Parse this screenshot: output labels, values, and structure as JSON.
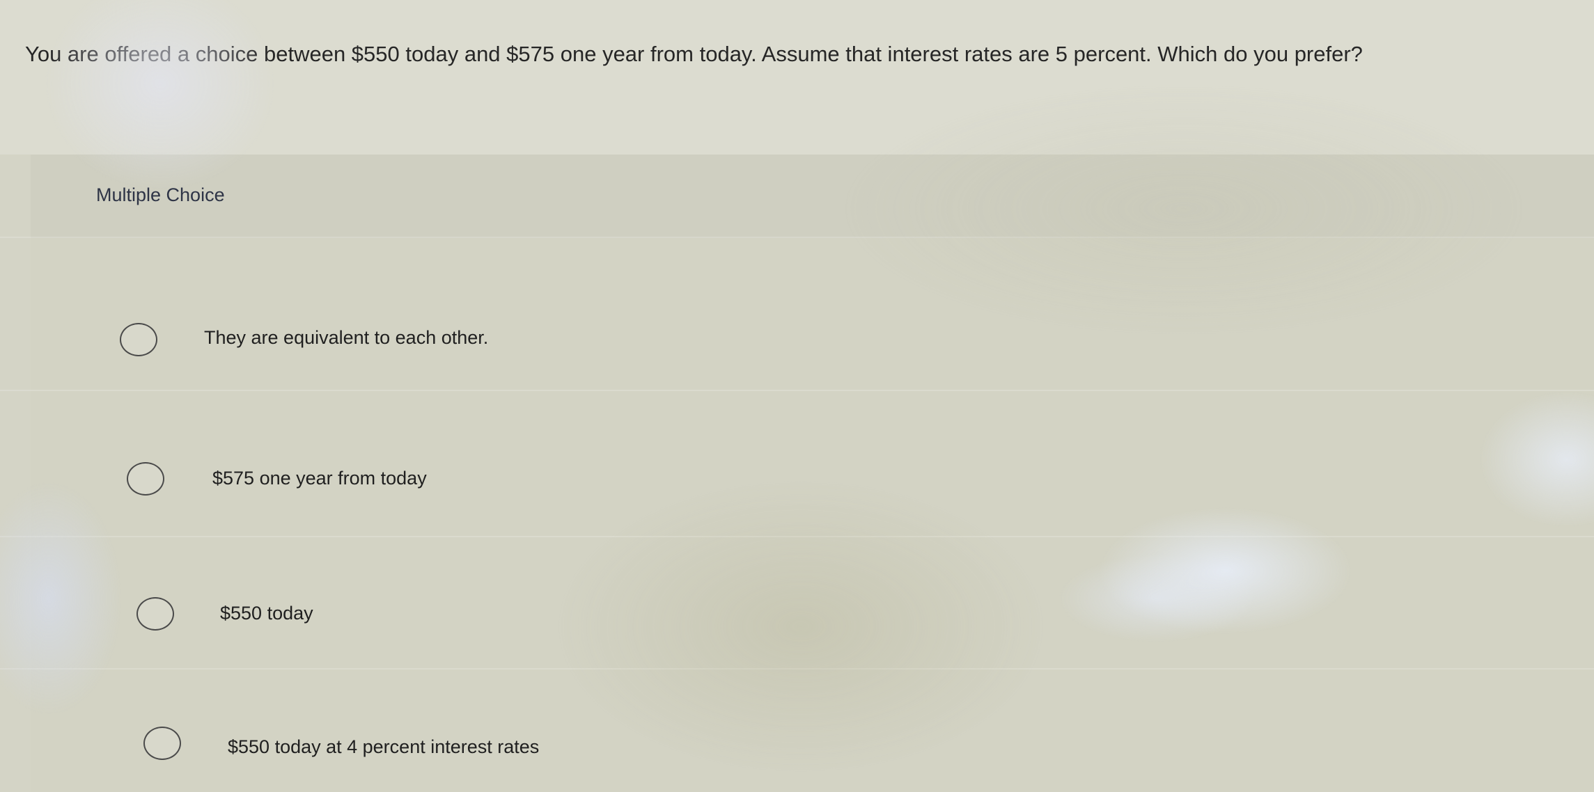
{
  "question": {
    "text": "You are offered a choice between $550 today and $575 one year from today. Assume that interest rates are 5 percent. Which do you prefer?"
  },
  "choices": {
    "label": "Multiple Choice",
    "options": [
      {
        "text": "They are equivalent to each other.",
        "selected": false
      },
      {
        "text": "$575 one year from today",
        "selected": false
      },
      {
        "text": "$550 today",
        "selected": false
      },
      {
        "text": "$550 today at 4 percent interest rates",
        "selected": false
      }
    ]
  }
}
